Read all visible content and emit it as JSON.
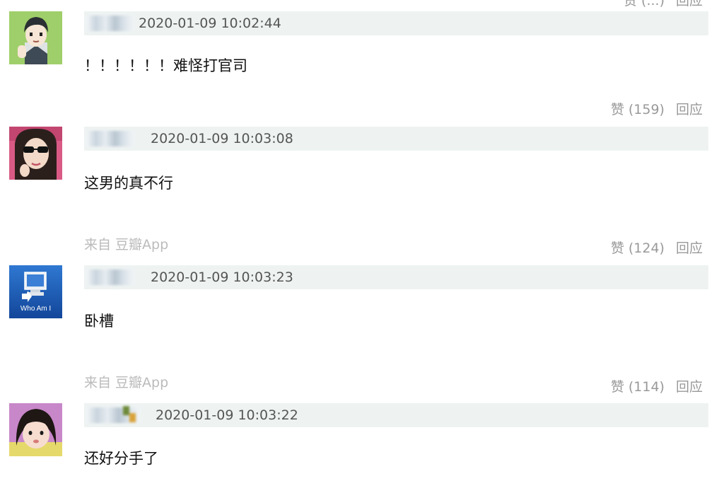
{
  "top_fragment": {
    "vote_label": "赞 (...)",
    "reply_label": "回应"
  },
  "comments": [
    {
      "time": "2020-01-09 10:02:44",
      "content": "！！！！！！难怪打官司",
      "vote_label": "赞 (159)",
      "reply_label": "回应",
      "source": ""
    },
    {
      "time": "2020-01-09 10:03:08",
      "content": "这男的真不行",
      "vote_label": "赞 (124)",
      "reply_label": "回应",
      "source": "来自 豆瓣App"
    },
    {
      "time": "2020-01-09 10:03:23",
      "content": "卧槽",
      "vote_label": "赞 (114)",
      "reply_label": "回应",
      "source": "来自 豆瓣App"
    },
    {
      "time": "2020-01-09 10:03:22",
      "content": "还好分手了",
      "source": ""
    }
  ],
  "avatars": {
    "avatar_3_caption": "Who Am I"
  },
  "colors": {
    "meta_bg": "#eef3f2",
    "action_text": "#999999",
    "source_text": "#bbbbbb",
    "time_text": "#555555"
  }
}
